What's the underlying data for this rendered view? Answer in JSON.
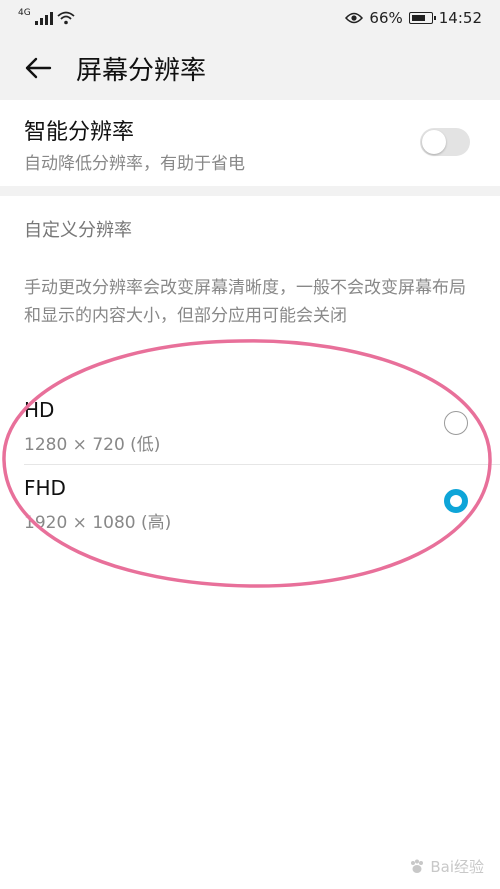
{
  "status_bar": {
    "network": "4G",
    "battery_percent": "66%",
    "time": "14:52",
    "icons": [
      "signal-icon",
      "wifi-icon",
      "eye-comfort-icon",
      "battery-icon"
    ]
  },
  "header": {
    "title": "屏幕分辨率",
    "back_icon": "back-arrow-icon"
  },
  "smart_resolution": {
    "title": "智能分辨率",
    "subtitle": "自动降低分辨率，有助于省电",
    "enabled": false
  },
  "custom_resolution": {
    "heading": "自定义分辨率",
    "description": "手动更改分辨率会改变屏幕清晰度，一般不会改变屏幕布局和显示的内容大小，但部分应用可能会关闭",
    "options": [
      {
        "label": "HD",
        "detail": "1280 × 720 (低)",
        "selected": false
      },
      {
        "label": "FHD",
        "detail": "1920 × 1080 (高)",
        "selected": true
      }
    ]
  },
  "annotation": {
    "color": "#e8709a"
  },
  "colors": {
    "accent": "#0ea5d8",
    "background": "#f2f2f2"
  },
  "watermark": {
    "text": "Bai经验"
  }
}
